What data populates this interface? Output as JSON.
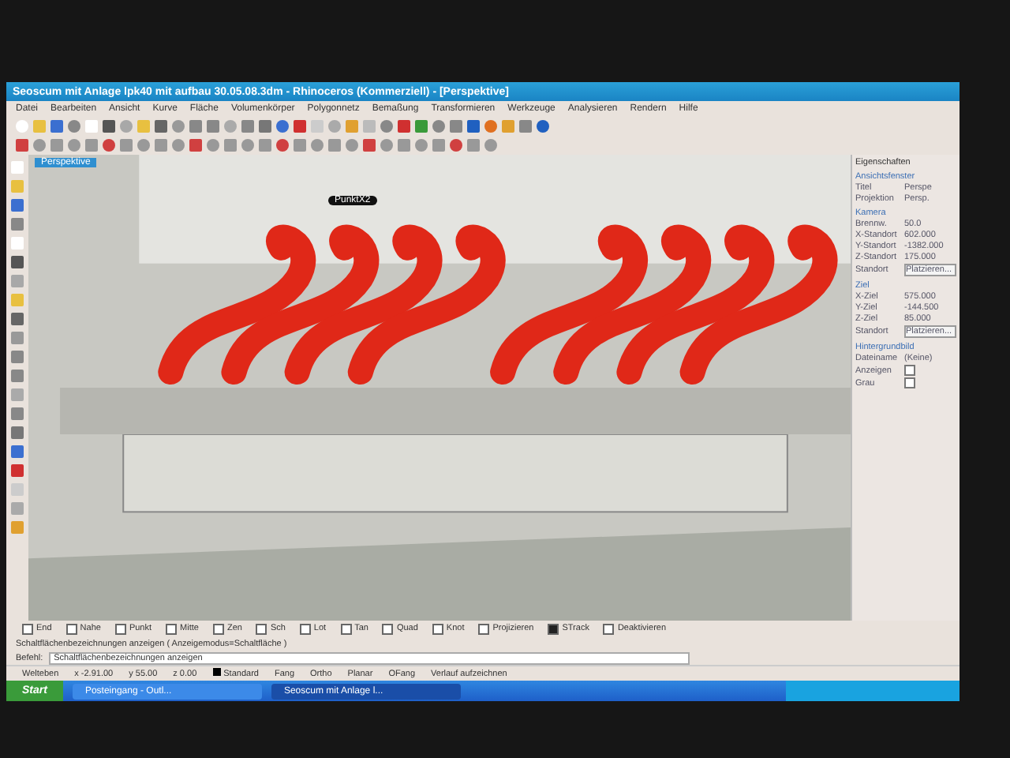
{
  "window": {
    "title": "Seoscum mit Anlage lpk40 mit aufbau 30.05.08.3dm - Rhinoceros (Kommerziell) - [Perspektive]"
  },
  "menu": [
    "Datei",
    "Bearbeiten",
    "Ansicht",
    "Kurve",
    "Fläche",
    "Volumenkörper",
    "Polygonnetz",
    "Bemaßung",
    "Transformieren",
    "Werkzeuge",
    "Analysieren",
    "Rendern",
    "Hilfe"
  ],
  "viewport": {
    "title": "Perspektive",
    "tag": "PunktX2"
  },
  "properties": {
    "title": "Eigenschaften",
    "sections": [
      {
        "heading": "Ansichtsfenster",
        "rows": [
          {
            "kind": "text",
            "label": "Titel",
            "value": "Perspe"
          },
          {
            "kind": "text",
            "label": "Projektion",
            "value": "Persp."
          }
        ]
      },
      {
        "heading": "Kamera",
        "rows": [
          {
            "kind": "text",
            "label": "Brennw.",
            "value": "50.0"
          },
          {
            "kind": "text",
            "label": "X-Standort",
            "value": "602.000"
          },
          {
            "kind": "text",
            "label": "Y-Standort",
            "value": "-1382.000"
          },
          {
            "kind": "text",
            "label": "Z-Standort",
            "value": "175.000"
          },
          {
            "kind": "button",
            "label": "Standort",
            "value": "Platzieren..."
          }
        ]
      },
      {
        "heading": "Ziel",
        "rows": [
          {
            "kind": "text",
            "label": "X-Ziel",
            "value": "575.000"
          },
          {
            "kind": "text",
            "label": "Y-Ziel",
            "value": "-144.500"
          },
          {
            "kind": "text",
            "label": "Z-Ziel",
            "value": "85.000"
          },
          {
            "kind": "button",
            "label": "Standort",
            "value": "Platzieren..."
          }
        ]
      },
      {
        "heading": "Hintergrundbild",
        "rows": [
          {
            "kind": "text",
            "label": "Dateiname",
            "value": "(Keine)"
          },
          {
            "kind": "check",
            "label": "Anzeigen",
            "checked": false
          },
          {
            "kind": "check",
            "label": "Grau",
            "checked": false
          }
        ]
      }
    ]
  },
  "snaps": [
    {
      "label": "End",
      "checked": false
    },
    {
      "label": "Nahe",
      "checked": false
    },
    {
      "label": "Punkt",
      "checked": false
    },
    {
      "label": "Mitte",
      "checked": false
    },
    {
      "label": "Zen",
      "checked": false
    },
    {
      "label": "Sch",
      "checked": false
    },
    {
      "label": "Lot",
      "checked": false
    },
    {
      "label": "Tan",
      "checked": false
    },
    {
      "label": "Quad",
      "checked": false
    },
    {
      "label": "Knot",
      "checked": false
    },
    {
      "label": "Projizieren",
      "checked": false
    },
    {
      "label": "STrack",
      "checked": true
    },
    {
      "label": "Deaktivieren",
      "checked": false
    }
  ],
  "command": {
    "history": "Schaltflächenbezeichnungen anzeigen ( Anzeigemodus=Schaltfläche )",
    "prompt": "Befehl:",
    "input": "Schaltflächenbezeichnungen anzeigen"
  },
  "status": {
    "coords": [
      "Welteben",
      "x -2.91.00",
      "y 55.00",
      "z 0.00"
    ],
    "layer": "Standard",
    "toggles": [
      "Fang",
      "Ortho",
      "Planar",
      "OFang"
    ],
    "history": "Verlauf aufzeichnen"
  },
  "taskbar": {
    "start": "Start",
    "tasks": [
      {
        "label": "Posteingang - Outl...",
        "selected": false
      },
      {
        "label": "Seoscum mit Anlage l...",
        "selected": true
      }
    ]
  }
}
